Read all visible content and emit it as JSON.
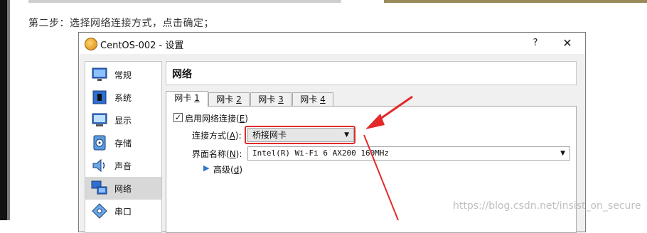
{
  "caption": "第二步：选择网络连接方式，点击确定；",
  "dialog": {
    "title": "CentOS-002 - 设置",
    "help_label": "?",
    "close_label": "✕"
  },
  "sidebar": {
    "items": [
      {
        "label": "常规",
        "icon": "monitor-icon"
      },
      {
        "label": "系统",
        "icon": "chip-icon"
      },
      {
        "label": "显示",
        "icon": "display-icon"
      },
      {
        "label": "存储",
        "icon": "disk-icon"
      },
      {
        "label": "声音",
        "icon": "speaker-icon"
      },
      {
        "label": "网络",
        "icon": "network-icon",
        "selected": true
      },
      {
        "label": "串口",
        "icon": "serial-port-icon"
      }
    ]
  },
  "panel": {
    "title": "网络",
    "tabs": [
      {
        "label": "网卡 ",
        "num": "1"
      },
      {
        "label": "网卡 ",
        "num": "2"
      },
      {
        "label": "网卡 ",
        "num": "3"
      },
      {
        "label": "网卡 ",
        "num": "4"
      }
    ],
    "enable_label_pre": "启用网络连接(",
    "enable_label_key": "E",
    "enable_label_post": ")",
    "enable_checked": true,
    "check_mark": "✓",
    "attach_label_pre": "连接方式(",
    "attach_label_key": "A",
    "attach_label_post": "):",
    "attach_value": "桥接网卡",
    "name_label_pre": "界面名称(",
    "name_label_key": "N",
    "name_label_post": "):",
    "name_value": "Intel(R) Wi-Fi 6 AX200 160MHz",
    "advanced_label_pre": "高级(",
    "advanced_label_key": "d",
    "advanced_label_post": ")",
    "advanced_arrow": "▶",
    "dropdown_arrow": "▼"
  },
  "watermark": "https://blog.csdn.net/insist_on_secure",
  "colors": {
    "annotation_red": "#e32a2a",
    "selected_item": "#d8d8d8",
    "window_bg": "#f0f0f0"
  }
}
